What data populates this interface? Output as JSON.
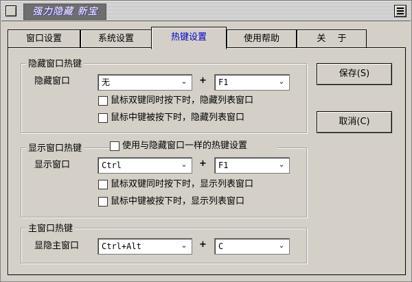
{
  "window": {
    "title": "强力隐藏 新宝"
  },
  "tabs": [
    {
      "label": "窗口设置",
      "active": false
    },
    {
      "label": "系统设置",
      "active": false
    },
    {
      "label": "热键设置",
      "active": true
    },
    {
      "label": "使用帮助",
      "active": false
    },
    {
      "label": "关　 于",
      "active": false
    }
  ],
  "hide_group": {
    "title": "隐藏窗口热键",
    "row_label": "隐藏窗口",
    "key1": "无",
    "plus": "+",
    "key2": "F1",
    "checkbox1": {
      "label": "鼠标双键同时按下时，隐藏列表窗口",
      "checked": false
    },
    "checkbox2": {
      "label": "鼠标中键被按下时，隐藏列表窗口",
      "checked": false
    }
  },
  "show_group": {
    "title": "显示窗口热键",
    "same_checkbox": {
      "label": "使用与隐藏窗口一样的热键设置",
      "checked": false
    },
    "row_label": "显示窗口",
    "key1": "Ctrl",
    "plus": "+",
    "key2": "F1",
    "checkbox1": {
      "label": "鼠标双键同时按下时，显示列表窗口",
      "checked": false
    },
    "checkbox2": {
      "label": "鼠标中键被按下时，显示列表窗口",
      "checked": false
    }
  },
  "main_group": {
    "title": "主窗口热键",
    "row_label": "显隐主窗口",
    "key1": "Ctrl+Alt",
    "plus": "+",
    "key2": "C"
  },
  "buttons": {
    "save": "保存(S)",
    "cancel": "取消(C)"
  },
  "icons": {
    "dropdown": "chevron-down-icon",
    "close": "close-box-icon",
    "menu": "menu-icon"
  }
}
